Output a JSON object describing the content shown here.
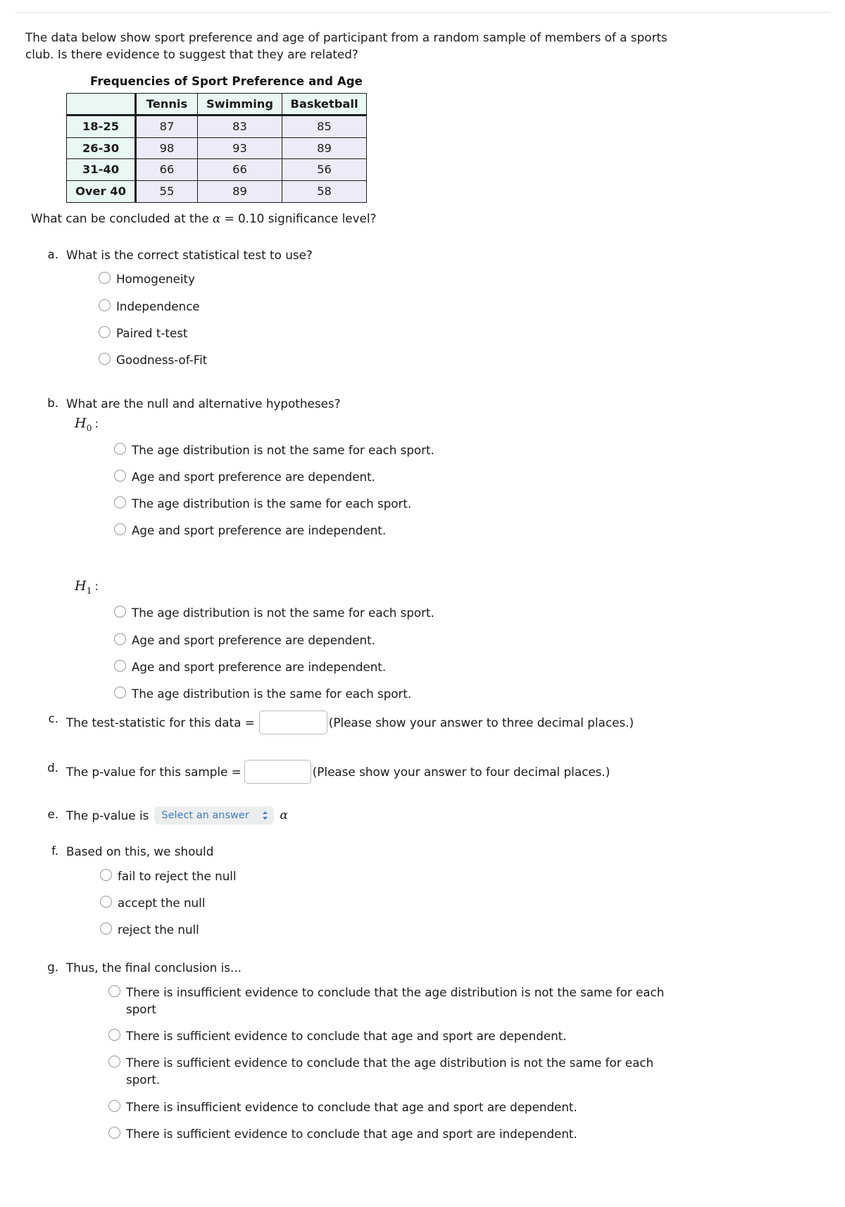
{
  "intro": {
    "text": "The data below show sport preference and age of participant from a random sample of members of a sports club. Is there evidence to suggest that they are related?"
  },
  "table": {
    "title": "Frequencies of Sport Preference and Age",
    "corner_label": "",
    "columns": [
      "Tennis",
      "Swimming",
      "Basketball"
    ],
    "rows": [
      {
        "label": "18-25",
        "values": [
          "87",
          "83",
          "85"
        ]
      },
      {
        "label": "26-30",
        "values": [
          "98",
          "93",
          "89"
        ]
      },
      {
        "label": "31-40",
        "values": [
          "66",
          "66",
          "56"
        ]
      },
      {
        "label": "Over 40",
        "values": [
          "55",
          "89",
          "58"
        ]
      }
    ],
    "header_fill": "#e9f7f5",
    "cell_fill": "#ecebf7"
  },
  "significance": {
    "prefix": "What can be concluded at the ",
    "alpha": "α",
    "equals": " = 0.10 significance level?"
  },
  "parts": {
    "a": {
      "letter": "a.",
      "question": "What is the correct statistical test to use?",
      "options": [
        "Homogeneity",
        "Independence",
        "Paired t-test",
        "Goodness-of-Fit"
      ]
    },
    "b": {
      "letter": "b.",
      "question": "What are the null and alternative hypotheses?",
      "h0_label": "H",
      "h0_sub": "0",
      "h1_label": "H",
      "h1_sub": "1",
      "colon": ":",
      "h0_options": [
        "The age distribution is not the same for each sport.",
        "Age and sport preference are dependent.",
        "The age distribution is the same for each sport.",
        "Age and sport preference are independent."
      ],
      "h1_options": [
        "The age distribution is not the same for each sport.",
        "Age and sport preference are dependent.",
        "Age and sport preference are independent.",
        "The age distribution is the same for each sport."
      ]
    },
    "c": {
      "letter": "c.",
      "label": "The test-statistic for this data =",
      "input_value": "",
      "input_placeholder": "",
      "hint": "(Please show your answer to three decimal places.)"
    },
    "d": {
      "letter": "d.",
      "label": "The p-value for this sample =",
      "input_value": "",
      "input_placeholder": "",
      "hint": "(Please show your answer to four decimal places.)"
    },
    "e": {
      "letter": "e.",
      "label": "The p-value is",
      "select_value": "Select an answer",
      "select_options": [
        "Select an answer"
      ],
      "alpha": "α"
    },
    "f": {
      "letter": "f.",
      "question": "Based on this, we should",
      "options": [
        "fail to reject the null",
        "accept the null",
        "reject the null"
      ]
    },
    "g": {
      "letter": "g.",
      "question": "Thus, the final conclusion is...",
      "options": [
        "There is insufficient evidence to conclude that the age distribution is not the same for each sport",
        "There is sufficient evidence to conclude that age and sport are dependent.",
        "There is sufficient evidence to conclude that the age distribution is not the same for each sport.",
        "There is insufficient evidence to conclude that age and sport are dependent.",
        "There is sufficient evidence to conclude that age and sport are independent."
      ]
    }
  },
  "colors": {
    "select_text": "#3d7fc1",
    "select_bg": "#eceded",
    "table_border": "#1d1d1d"
  }
}
